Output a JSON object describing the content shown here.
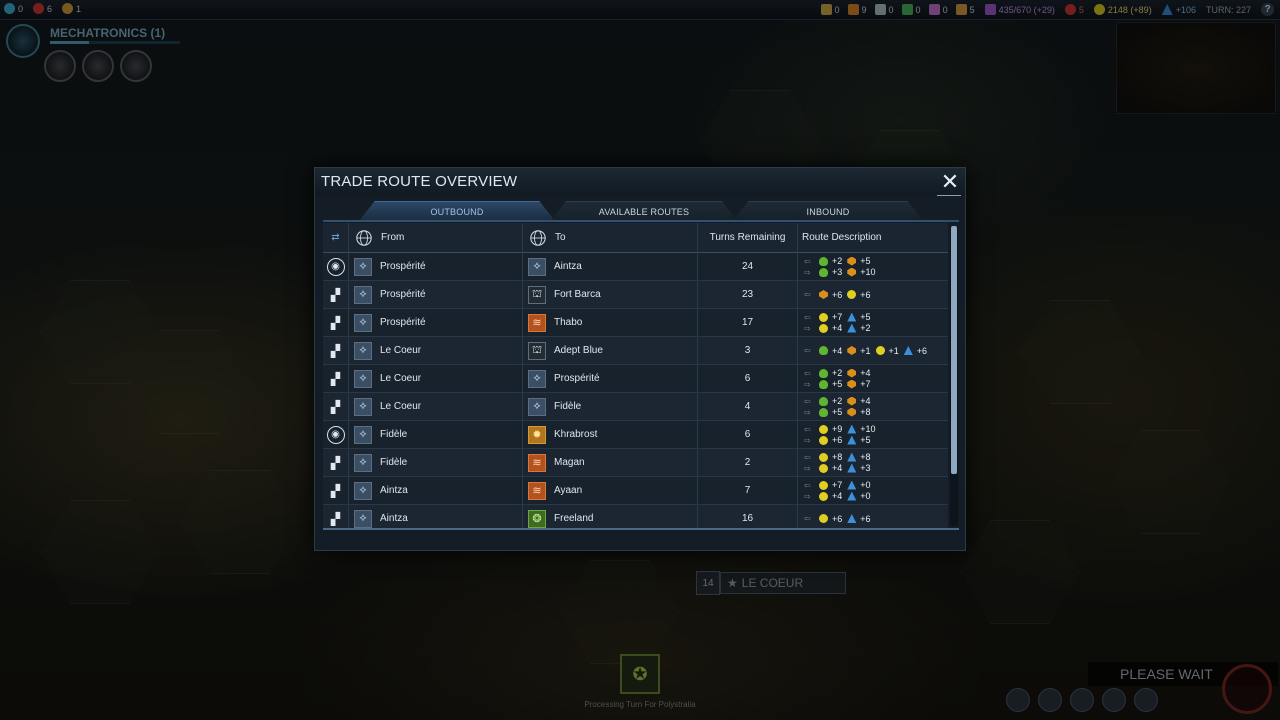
{
  "topbar": {
    "left": [
      {
        "icon": "affinity-purity-icon",
        "value": "0",
        "color": "#3fb7d9"
      },
      {
        "icon": "affinity-harmony-icon",
        "value": "6",
        "color": "#d93a3a"
      },
      {
        "icon": "affinity-supremacy-icon",
        "value": "1",
        "color": "#d9a23a"
      }
    ],
    "resources": [
      {
        "icon": "firaxite-icon",
        "value": "0"
      },
      {
        "icon": "geothermal-icon",
        "value": "9"
      },
      {
        "icon": "floatstone-icon",
        "value": "0"
      },
      {
        "icon": "xenomass-icon",
        "value": "0"
      },
      {
        "icon": "titanium-icon",
        "value": "0"
      },
      {
        "icon": "petroleum-icon",
        "value": "5"
      }
    ],
    "culture": "435/670 (+29)",
    "health": "5",
    "energy": "2148 (+89)",
    "science": "+106",
    "turn": "TURN: 227",
    "help": "?"
  },
  "tech": {
    "title": "MECHATRONICS (1)"
  },
  "city_banner": {
    "pop": "14",
    "name": "LE COEUR"
  },
  "processing": {
    "text": "Processing Turn For Polystralia"
  },
  "please_wait": "PLEASE WAIT",
  "dialog": {
    "title": "TRADE ROUTE OVERVIEW",
    "close": "✕",
    "tabs": [
      "OUTBOUND",
      "AVAILABLE ROUTES",
      "INBOUND"
    ],
    "columns": {
      "from": "From",
      "to": "To",
      "turns": "Turns Remaining",
      "desc": "Route Description"
    },
    "rows": [
      {
        "type": "station",
        "from": "Prospérité",
        "to": "Aintza",
        "to_style": "blue",
        "turns": "24",
        "desc": [
          [
            {
              "k": "food",
              "v": "+2"
            },
            {
              "k": "prod",
              "v": "+5"
            }
          ],
          [
            {
              "k": "food",
              "v": "+3"
            },
            {
              "k": "prod",
              "v": "+10"
            }
          ]
        ]
      },
      {
        "type": "convoy",
        "from": "Prospérité",
        "to": "Fort Barca",
        "to_style": "dark",
        "turns": "23",
        "desc": [
          [
            {
              "k": "prod",
              "v": "+6"
            },
            {
              "k": "energy",
              "v": "+6"
            }
          ]
        ]
      },
      {
        "type": "convoy",
        "from": "Prospérité",
        "to": "Thabo",
        "to_style": "orange",
        "turns": "17",
        "desc": [
          [
            {
              "k": "energy",
              "v": "+7"
            },
            {
              "k": "science",
              "v": "+5"
            }
          ],
          [
            {
              "k": "energy",
              "v": "+4"
            },
            {
              "k": "science",
              "v": "+2"
            }
          ]
        ]
      },
      {
        "type": "convoy",
        "from": "Le Coeur",
        "to": "Adept Blue",
        "to_style": "dark",
        "turns": "3",
        "desc": [
          [
            {
              "k": "food",
              "v": "+4"
            },
            {
              "k": "prod",
              "v": "+1"
            },
            {
              "k": "energy",
              "v": "+1"
            },
            {
              "k": "science",
              "v": "+6"
            }
          ]
        ]
      },
      {
        "type": "convoy",
        "from": "Le Coeur",
        "to": "Prospérité",
        "to_style": "blue",
        "turns": "6",
        "desc": [
          [
            {
              "k": "food",
              "v": "+2"
            },
            {
              "k": "prod",
              "v": "+4"
            }
          ],
          [
            {
              "k": "food",
              "v": "+5"
            },
            {
              "k": "prod",
              "v": "+7"
            }
          ]
        ]
      },
      {
        "type": "convoy",
        "from": "Le Coeur",
        "to": "Fidèle",
        "to_style": "blue",
        "turns": "4",
        "desc": [
          [
            {
              "k": "food",
              "v": "+2"
            },
            {
              "k": "prod",
              "v": "+4"
            }
          ],
          [
            {
              "k": "food",
              "v": "+5"
            },
            {
              "k": "prod",
              "v": "+8"
            }
          ]
        ]
      },
      {
        "type": "station",
        "from": "Fidèle",
        "to": "Khrabrost",
        "to_style": "gold",
        "turns": "6",
        "desc": [
          [
            {
              "k": "energy",
              "v": "+9"
            },
            {
              "k": "science",
              "v": "+10"
            }
          ],
          [
            {
              "k": "energy",
              "v": "+6"
            },
            {
              "k": "science",
              "v": "+5"
            }
          ]
        ]
      },
      {
        "type": "convoy",
        "from": "Fidèle",
        "to": "Magan",
        "to_style": "orange",
        "turns": "2",
        "desc": [
          [
            {
              "k": "energy",
              "v": "+8"
            },
            {
              "k": "science",
              "v": "+8"
            }
          ],
          [
            {
              "k": "energy",
              "v": "+4"
            },
            {
              "k": "science",
              "v": "+3"
            }
          ]
        ]
      },
      {
        "type": "convoy",
        "from": "Aintza",
        "to": "Ayaan",
        "to_style": "orange",
        "turns": "7",
        "desc": [
          [
            {
              "k": "energy",
              "v": "+7"
            },
            {
              "k": "science",
              "v": "+0"
            }
          ],
          [
            {
              "k": "energy",
              "v": "+4"
            },
            {
              "k": "science",
              "v": "+0"
            }
          ]
        ]
      },
      {
        "type": "convoy",
        "from": "Aintza",
        "to": "Freeland",
        "to_style": "green",
        "turns": "16",
        "desc": [
          [
            {
              "k": "energy",
              "v": "+6"
            },
            {
              "k": "science",
              "v": "+6"
            }
          ]
        ]
      }
    ]
  }
}
